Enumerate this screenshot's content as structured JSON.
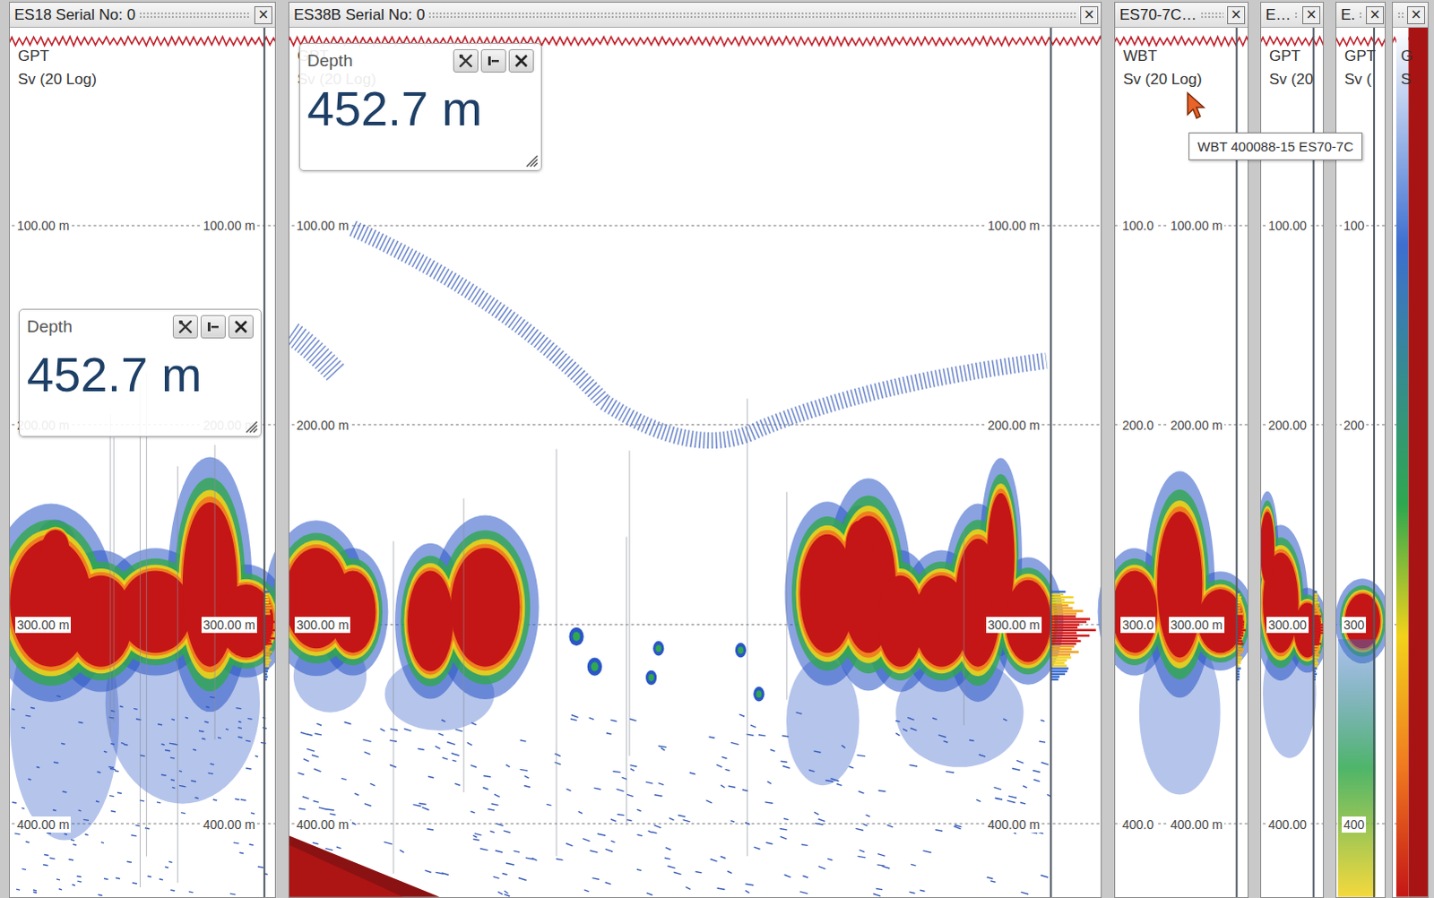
{
  "panels": [
    {
      "title": "ES18 Serial No: 0",
      "close": "×",
      "channel": "GPT",
      "quantity": "Sv (20 Log)",
      "ticks": [
        {
          "left": "100.00 m",
          "right": "100.00 m"
        },
        {
          "left": "200.00 m",
          "right": "200.00 m"
        },
        {
          "left": "300.00 m",
          "right": "300.00 m"
        },
        {
          "left": "400.00 m",
          "right": "400.00 m"
        }
      ],
      "depth_widget": {
        "title": "Depth",
        "value": "452.7 m"
      }
    },
    {
      "title": "ES38B Serial No: 0",
      "close": "×",
      "channel": "GPT",
      "quantity": "Sv (20 Log)",
      "ticks": [
        {
          "left": "100.00 m",
          "right": "100.00 m"
        },
        {
          "left": "200.00 m",
          "right": "200.00 m"
        },
        {
          "left": "300.00 m",
          "right": "300.00 m"
        },
        {
          "left": "400.00 m",
          "right": "400.00 m"
        }
      ],
      "depth_widget": {
        "title": "Depth",
        "value": "452.7 m"
      }
    },
    {
      "title": "ES70-7C…",
      "close": "×",
      "channel": "WBT",
      "quantity": "Sv (20 Log)",
      "ticks": [
        {
          "left": "100.0",
          "right": "100.00 m"
        },
        {
          "left": "200.0",
          "right": "200.00 m"
        },
        {
          "left": "300.0",
          "right": "300.00 m"
        },
        {
          "left": "400.0",
          "right": "400.00 m"
        }
      ]
    },
    {
      "title": "E…",
      "close": "×",
      "channel": "GPT",
      "quantity": "Sv (20",
      "ticks": [
        {
          "left": "100.00"
        },
        {
          "left": "200.00"
        },
        {
          "left": "300.00"
        },
        {
          "left": "400.00"
        }
      ]
    },
    {
      "title": "E.",
      "close": "×",
      "channel": "GPT",
      "quantity": "Sv (",
      "ticks": [
        {
          "left": "100"
        },
        {
          "left": "200"
        },
        {
          "left": "300"
        },
        {
          "left": "400"
        }
      ]
    },
    {
      "close": "×",
      "channel": "G",
      "quantity": "S",
      "ticks": []
    }
  ],
  "tooltip": {
    "text": "WBT 400088-15 ES70-7C"
  }
}
